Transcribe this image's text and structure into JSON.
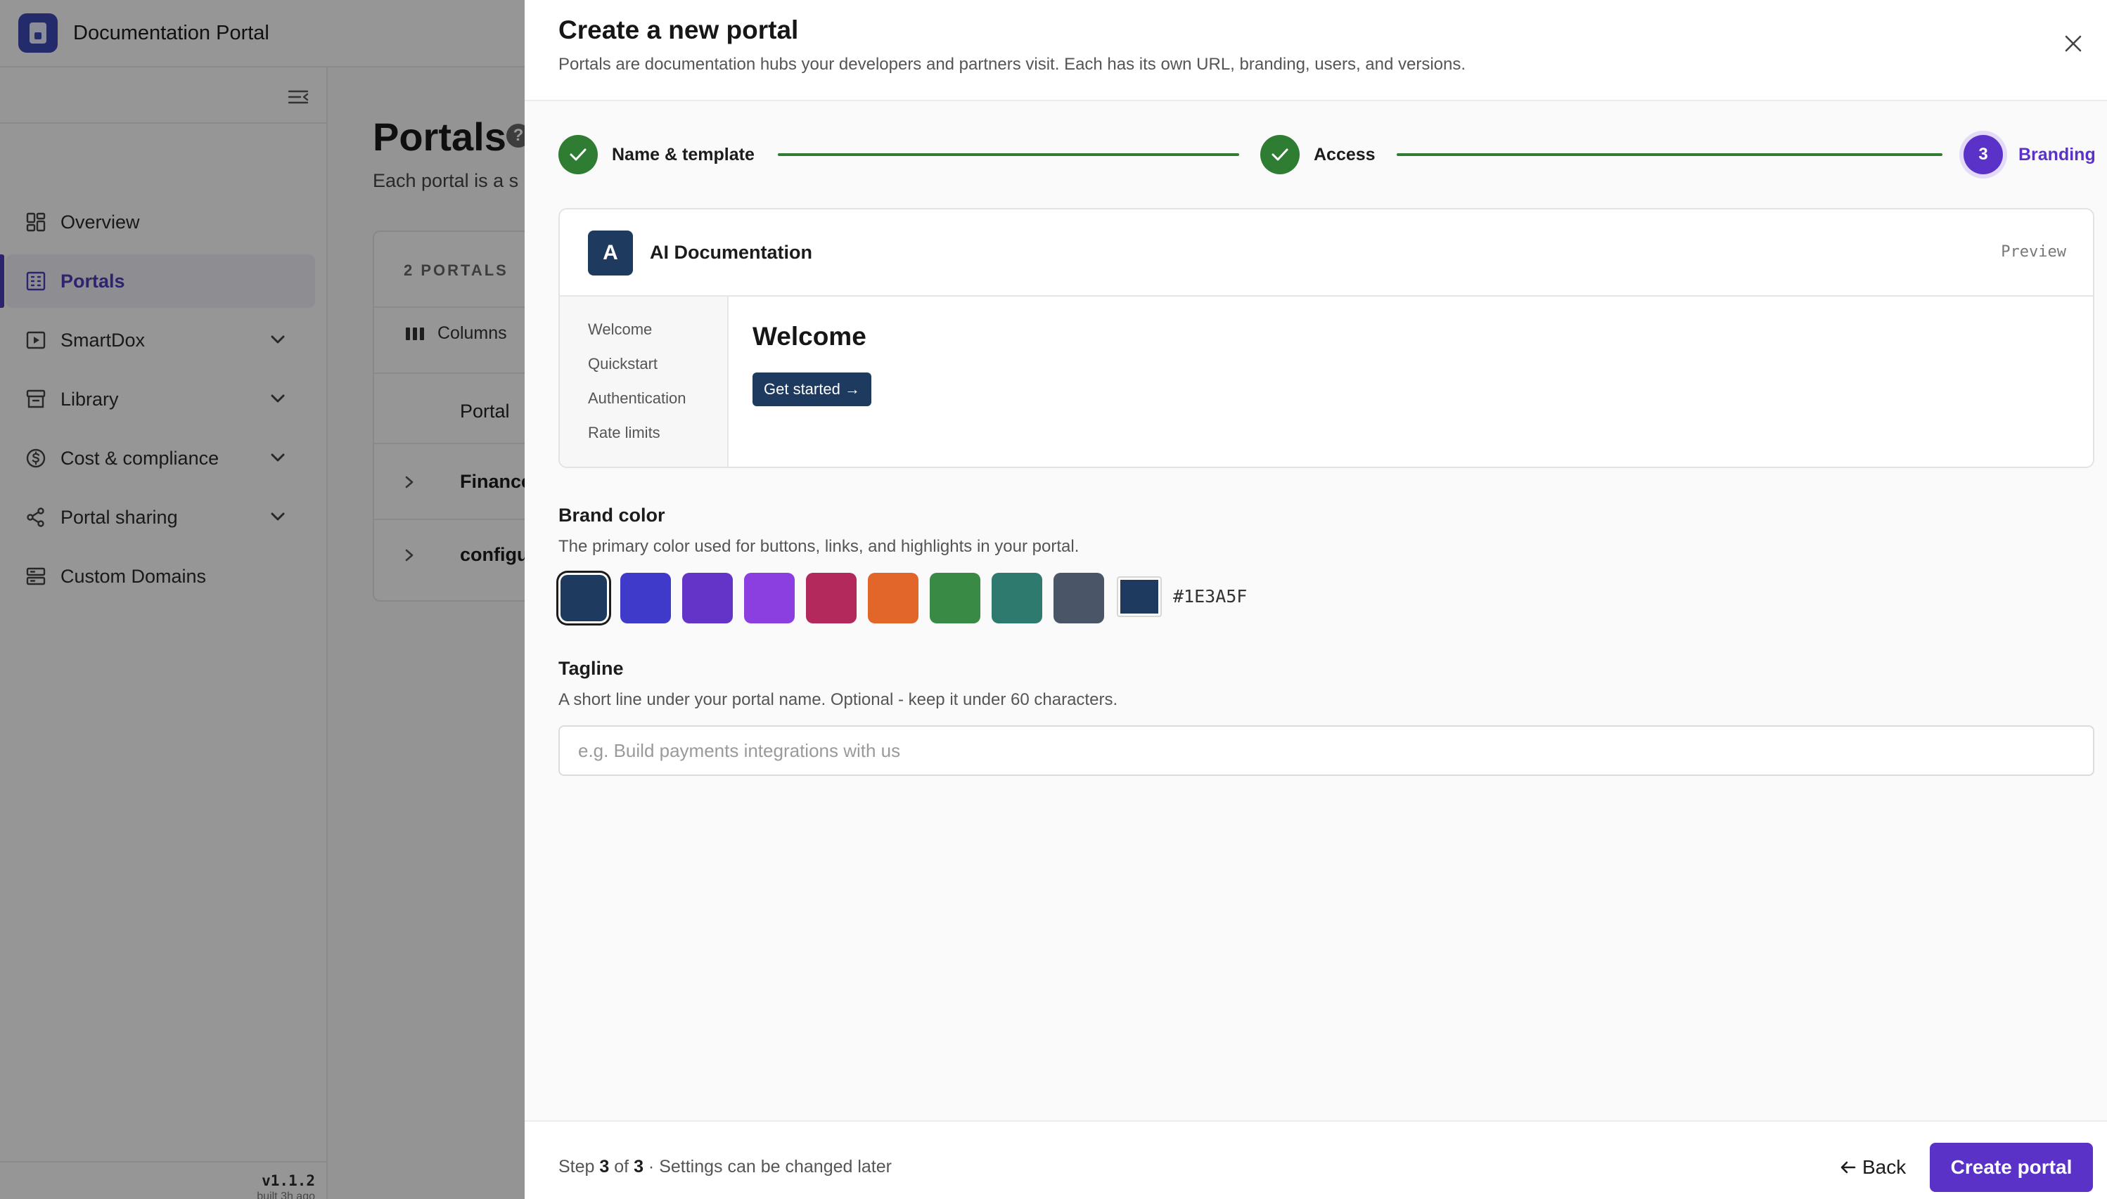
{
  "app": {
    "title": "Documentation Portal"
  },
  "sidebar": {
    "items": [
      {
        "label": "Overview",
        "icon": "dashboard-icon",
        "active": false,
        "expandable": false
      },
      {
        "label": "Portals",
        "icon": "building-icon",
        "active": true,
        "expandable": false
      },
      {
        "label": "SmartDox",
        "icon": "play-square-icon",
        "active": false,
        "expandable": true
      },
      {
        "label": "Library",
        "icon": "archive-icon",
        "active": false,
        "expandable": true
      },
      {
        "label": "Cost & compliance",
        "icon": "dollar-circle-icon",
        "active": false,
        "expandable": true
      },
      {
        "label": "Portal sharing",
        "icon": "share-icon",
        "active": false,
        "expandable": true
      },
      {
        "label": "Custom Domains",
        "icon": "server-icon",
        "active": false,
        "expandable": false
      }
    ],
    "version": "v1.1.2",
    "built": "built 3h ago"
  },
  "main": {
    "title": "Portals",
    "subtitle": "Each portal is a s",
    "table": {
      "count_label": "2 PORTALS",
      "columns_button": "Columns",
      "column_header": "Portal",
      "rows": [
        "Finance",
        "configu"
      ]
    }
  },
  "drawer": {
    "title": "Create a new portal",
    "description": "Portals are documentation hubs your developers and partners visit. Each has its own URL, branding, users, and versions.",
    "steps": [
      {
        "label": "Name & template",
        "status": "done",
        "number": "1"
      },
      {
        "label": "Access",
        "status": "done",
        "number": "2"
      },
      {
        "label": "Branding",
        "status": "current",
        "number": "3"
      }
    ],
    "preview": {
      "avatar_letter": "A",
      "portal_name": "AI Documentation",
      "tag": "Preview",
      "nav": [
        "Welcome",
        "Quickstart",
        "Authentication",
        "Rate limits"
      ],
      "heading": "Welcome",
      "cta": "Get started →"
    },
    "brand_color": {
      "label": "Brand color",
      "description": "The primary color used for buttons, links, and highlights in your portal.",
      "swatches": [
        "#1E3A5F",
        "#3F3AC9",
        "#6434C8",
        "#8B3FE0",
        "#B3295B",
        "#E2652A",
        "#388A45",
        "#2F7A6E",
        "#4A5568"
      ],
      "selected_index": 0,
      "hex": "#1E3A5F"
    },
    "tagline": {
      "label": "Tagline",
      "description": "A short line under your portal name. Optional - keep it under 60 characters.",
      "placeholder": "e.g. Build payments integrations with us",
      "value": ""
    },
    "footer": {
      "step_prefix": "Step",
      "step_current": "3",
      "step_of": "of",
      "step_total": "3",
      "step_suffix": "· Settings can be changed later",
      "back_label": "Back",
      "create_label": "Create portal"
    },
    "colors": {
      "accent": "#5B32C8",
      "done": "#2E7D32"
    }
  }
}
